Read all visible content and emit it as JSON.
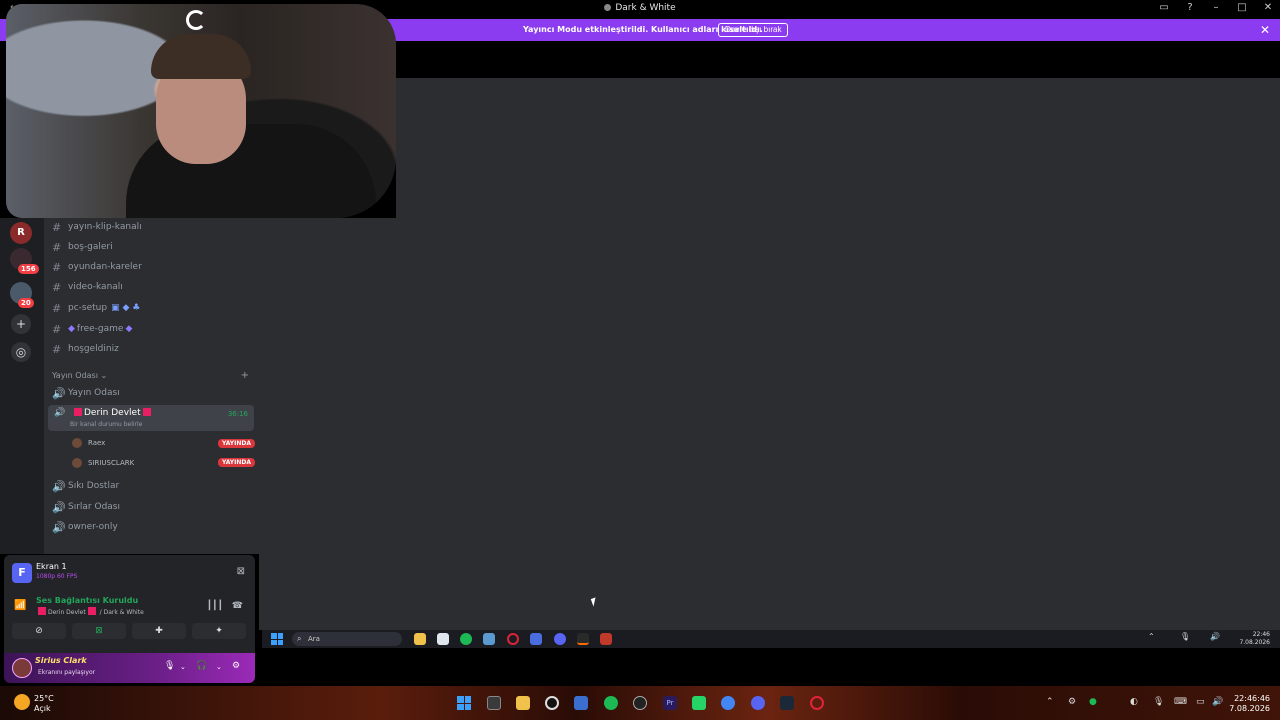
{
  "window": {
    "title": "Dark & White"
  },
  "banner": {
    "message": "Yayıncı Modu etkinleştirildi. Kullanıcı adları kısaltıldı.",
    "button": "Devre dışı bırak",
    "color": "#8c3cf0"
  },
  "rail": {
    "server_letter": "R",
    "badges": [
      "156",
      "20"
    ]
  },
  "channels": {
    "text": [
      "yayın-klip-kanalı",
      "boş-galeri",
      "oyundan-kareler",
      "video-kanalı",
      "pc-setup",
      "free-game",
      "hoşgeldiniz"
    ],
    "category": "Yayın Odası",
    "voice": [
      {
        "name": "Yayın Odası"
      },
      {
        "name": "Derin Devlet",
        "status": "Bir kanal durumu belirle",
        "time": "36:16",
        "active": true
      },
      {
        "name": "Sıkı Dostlar"
      },
      {
        "name": "Sırlar Odası"
      },
      {
        "name": "owner-only"
      }
    ],
    "members": [
      {
        "name": "Raex",
        "badge": "YAYINDA"
      },
      {
        "name": "SIRIUSCLARK",
        "badge": "YAYINDA"
      }
    ]
  },
  "screen_share": {
    "icon_letter": "F",
    "title": "Ekran 1",
    "quality": "1080p 60 FPS"
  },
  "voice_status": {
    "title": "Ses Bağlantısı Kuruldu",
    "channel": "Derin Devlet",
    "server": "/ Dark & White"
  },
  "user": {
    "name": "Sirius Clark",
    "status": "Ekranını paylaşıyor"
  },
  "inner_taskbar": {
    "search_placeholder": "Ara",
    "time": "22:46",
    "date": "7.08.2026"
  },
  "taskbar": {
    "temperature": "25°C",
    "weather": "Açık",
    "time": "22:46:46",
    "date": "7.08.2026"
  }
}
